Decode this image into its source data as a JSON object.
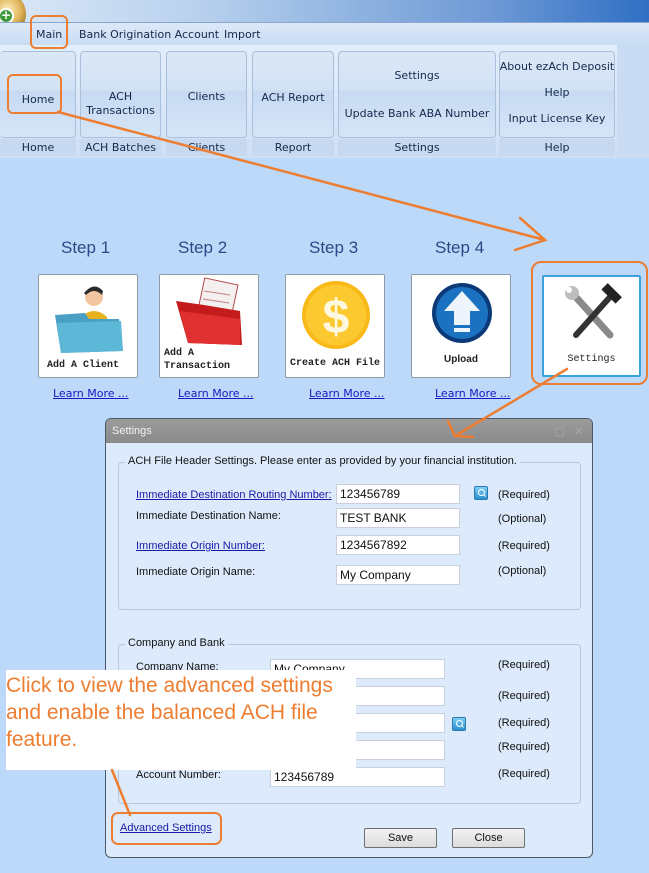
{
  "window": {
    "app_icon": "coins-plus-icon"
  },
  "ribbon": {
    "tabs": [
      {
        "label": "Main",
        "active": true
      },
      {
        "label": "Bank Origination Account",
        "active": false
      },
      {
        "label": "Import",
        "active": false
      }
    ],
    "groups": [
      {
        "label": "Home",
        "buttons": [
          "Home"
        ]
      },
      {
        "label": "ACH Batches",
        "buttons": [
          "ACH\nTransactions"
        ]
      },
      {
        "label": "Clients",
        "buttons": [
          "Clients"
        ]
      },
      {
        "label": "Report",
        "buttons": [
          "ACH Report"
        ]
      },
      {
        "label": "Settings",
        "buttons": [
          "Settings",
          "Update Bank ABA Number"
        ]
      },
      {
        "label": "Help",
        "buttons": [
          "About ezAch Deposit",
          "Help",
          "Input License Key"
        ]
      }
    ]
  },
  "steps": [
    {
      "label": "Step 1",
      "tile": "Add A Client",
      "icon": "client-folder-icon",
      "link": "Learn More ..."
    },
    {
      "label": "Step 2",
      "tile": "Add A Transaction",
      "icon": "transaction-folder-icon",
      "link": "Learn More ..."
    },
    {
      "label": "Step 3",
      "tile": "Create ACH File",
      "icon": "dollar-coin-icon",
      "link": "Learn More ..."
    },
    {
      "label": "Step 4",
      "tile": "Upload",
      "icon": "upload-arrow-icon",
      "link": "Learn More ..."
    }
  ],
  "settings_tile": {
    "label": "Settings",
    "icon": "tools-icon"
  },
  "dialog": {
    "title": "Settings",
    "controls": [
      "maximize",
      "close"
    ],
    "header_section": {
      "legend": "ACH File Header Settings.  Please enter as provided by your financial institution.",
      "fields": [
        {
          "label": "Immediate Destination Routing Number:",
          "value": "123456789",
          "status": "(Required)",
          "is_link": true,
          "lookup": true
        },
        {
          "label": "Immediate Destination Name:",
          "value": "TEST BANK",
          "status": "(Optional)",
          "is_link": false,
          "lookup": false
        },
        {
          "label": "Immediate Origin Number:",
          "value": "1234567892",
          "status": "(Required)",
          "is_link": true,
          "lookup": false
        },
        {
          "label": "Immediate Origin Name:",
          "value": "My Company",
          "status": "(Optional)",
          "is_link": false,
          "lookup": false
        }
      ]
    },
    "company_section": {
      "legend": "Company and Bank",
      "fields": [
        {
          "label": "Company Name:",
          "value": "My Company",
          "status": "(Required)",
          "lookup": false
        },
        {
          "label": "",
          "value": "",
          "status": "(Required)",
          "lookup": false
        },
        {
          "label": "",
          "value": "",
          "status": "(Required)",
          "lookup": true
        },
        {
          "label": "",
          "value": "",
          "status": "(Required)",
          "lookup": false
        },
        {
          "label": "Account Number:",
          "value": "123456789",
          "status": "(Required)",
          "lookup": false
        }
      ]
    },
    "advanced_link": "Advanced Settings",
    "save_label": "Save",
    "close_label": "Close"
  },
  "annotation": {
    "callout": "Click to view the advanced settings and enable the balanced ACH file feature.",
    "color": "#ed7d31"
  }
}
